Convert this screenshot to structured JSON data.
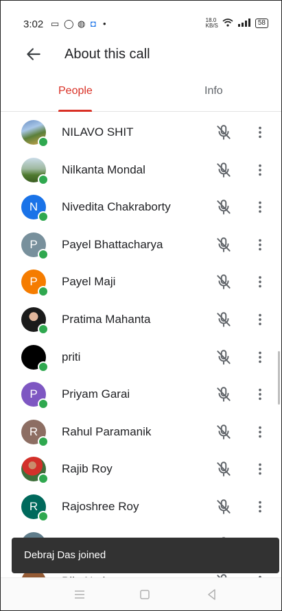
{
  "status_bar": {
    "time": "3:02",
    "net_speed_top": "18.0",
    "net_speed_bottom": "KB/S",
    "battery": "58"
  },
  "app_bar": {
    "title": "About this call"
  },
  "tabs": [
    {
      "label": "People"
    },
    {
      "label": "Info"
    }
  ],
  "participants": [
    {
      "name": "NILAVO SHIT",
      "avatar_type": "photo-landscape"
    },
    {
      "name": "Nilkanta Mondal",
      "avatar_type": "photo-field"
    },
    {
      "name": "Nivedita Chakraborty",
      "initial": "N",
      "avatar_color": "#1a73e8"
    },
    {
      "name": "Payel Bhattacharya",
      "initial": "P",
      "avatar_color": "#78909c"
    },
    {
      "name": "Payel Maji",
      "initial": "P",
      "avatar_color": "#f57c00"
    },
    {
      "name": "Pratima Mahanta",
      "avatar_type": "photo-person"
    },
    {
      "name": "priti",
      "avatar_type": "black"
    },
    {
      "name": "Priyam Garai",
      "initial": "P",
      "avatar_color": "#7e57c2"
    },
    {
      "name": "Rahul Paramanik",
      "initial": "R",
      "avatar_color": "#8d6e63"
    },
    {
      "name": "Rajib Roy",
      "avatar_type": "photo-person-red"
    },
    {
      "name": "Rajoshree Roy",
      "initial": "R",
      "avatar_color": "#00695c"
    },
    {
      "name": "",
      "avatar_type": "partial",
      "avatar_color": "#607d8b"
    },
    {
      "name": "Biju Nath",
      "avatar_type": "photo-brown"
    }
  ],
  "toast": {
    "message": "Debraj Das joined"
  },
  "colors": {
    "accent": "#d93025",
    "online": "#2fa84f",
    "toast_bg": "#323232"
  }
}
